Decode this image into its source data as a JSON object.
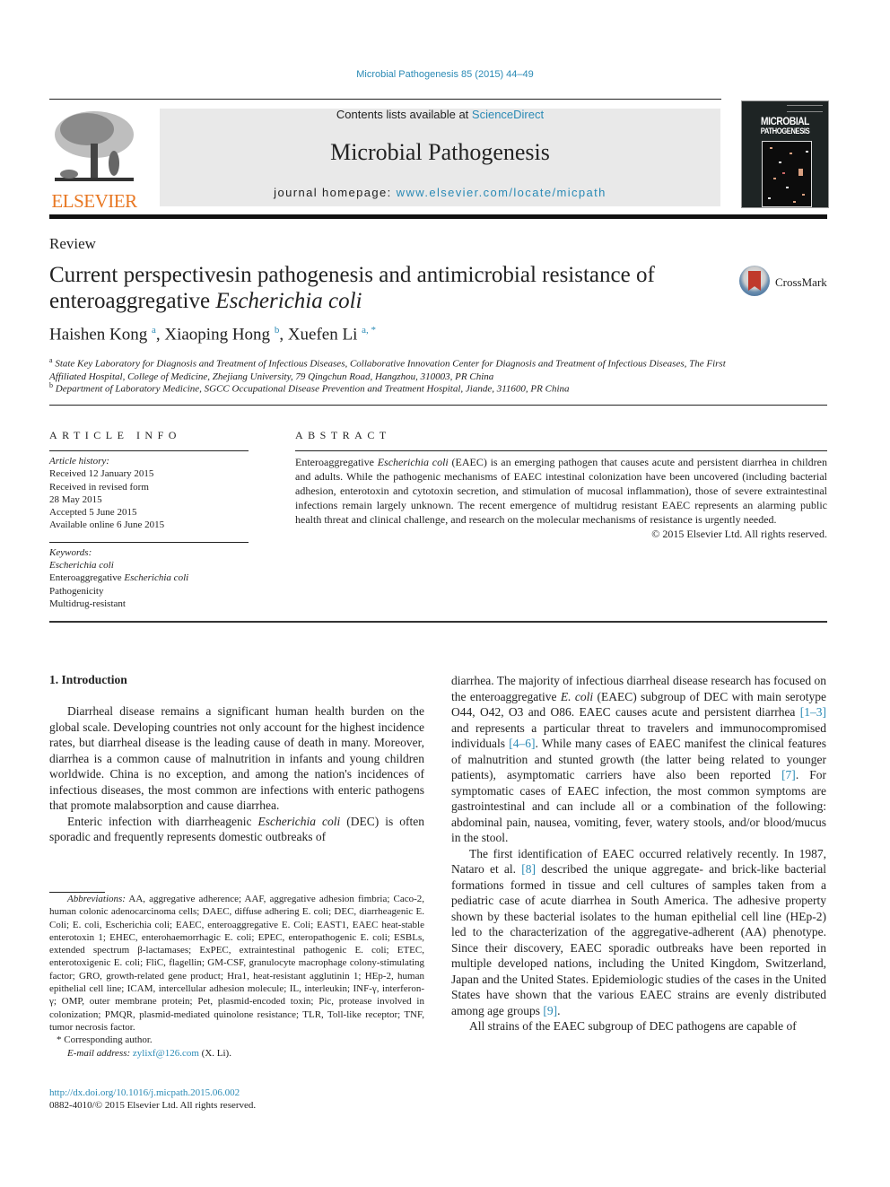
{
  "header": {
    "journal_citation": "Microbial Pathogenesis 85 (2015) 44–49",
    "publisher_logo_text": "ELSEVIER",
    "contents_prefix": "Contents lists available at ",
    "contents_link": "ScienceDirect",
    "journal_title": "Microbial Pathogenesis",
    "homepage_prefix": "journal homepage: ",
    "homepage_link": "www.elsevier.com/locate/micpath",
    "cover_title_line1": "MICROBIAL",
    "cover_title_line2": "PATHOGENESIS"
  },
  "article": {
    "type": "Review",
    "title_part1": "Current perspectivesin pathogenesis and antimicrobial resistance of enteroaggregative ",
    "title_italic": "Escherichia coli",
    "crossmark_label": "CrossMark",
    "authors": [
      {
        "name": "Haishen Kong",
        "sup": "a"
      },
      {
        "name": "Xiaoping Hong",
        "sup": "b"
      },
      {
        "name": "Xuefen Li",
        "sup": "a, *"
      }
    ],
    "affiliations": [
      {
        "mark": "a",
        "text": "State Key Laboratory for Diagnosis and Treatment of Infectious Diseases, Collaborative Innovation Center for Diagnosis and Treatment of Infectious Diseases, The First Affiliated Hospital, College of Medicine, Zhejiang University, 79 Qingchun Road, Hangzhou, 310003, PR China"
      },
      {
        "mark": "b",
        "text": "Department of Laboratory Medicine, SGCC Occupational Disease Prevention and Treatment Hospital, Jiande, 311600, PR China"
      }
    ]
  },
  "article_info": {
    "heading": "ARTICLE INFO",
    "history_label": "Article history:",
    "history": [
      "Received 12 January 2015",
      "Received in revised form",
      "28 May 2015",
      "Accepted 5 June 2015",
      "Available online 6 June 2015"
    ],
    "keywords_label": "Keywords:",
    "keyword1_italic": "Escherichia coli",
    "keyword2_prefix": "Enteroaggregative ",
    "keyword2_italic": "Escherichia coli",
    "keyword3": "Pathogenicity",
    "keyword4": "Multidrug-resistant"
  },
  "abstract": {
    "heading": "ABSTRACT",
    "p1_a": "Enteroaggregative ",
    "p1_i": "Escherichia coli",
    "p1_b": " (EAEC) is an emerging pathogen that causes acute and persistent diarrhea in children and adults. While the pathogenic mechanisms of EAEC intestinal colonization have been uncovered (including bacterial adhesion, enterotoxin and cytotoxin secretion, and stimulation of mucosal inflammation), those of severe extraintestinal infections remain largely unknown. The recent emergence of multidrug resistant EAEC represents an alarming public health threat and clinical challenge, and research on the molecular mechanisms of resistance is urgently needed.",
    "copyright": "© 2015 Elsevier Ltd. All rights reserved."
  },
  "body": {
    "section_heading": "1.  Introduction",
    "left_p1": "Diarrheal disease remains a significant human health burden on the global scale. Developing countries not only account for the highest incidence rates, but diarrheal disease is the leading cause of death in many. Moreover, diarrhea is a common cause of malnutrition in infants and young children worldwide. China is no exception, and among the nation's incidences of infectious diseases, the most common are infections with enteric pathogens that promote malabsorption and cause diarrhea.",
    "left_p2_a": "Enteric infection with diarrheagenic ",
    "left_p2_i": "Escherichia coli",
    "left_p2_b": " (DEC) is often sporadic and frequently represents domestic outbreaks of",
    "right_p1_a": "diarrhea. The majority of infectious diarrheal disease research has focused on the enteroaggregative ",
    "right_p1_i": "E. coli",
    "right_p1_b": " (EAEC) subgroup of DEC with main serotype O44, O42, O3 and O86. EAEC causes acute and persistent diarrhea ",
    "ref_1_3": "[1–3]",
    "right_p1_c": " and represents a particular threat to travelers and immunocompromised individuals ",
    "ref_4_6": "[4–6]",
    "right_p1_d": ". While many cases of EAEC manifest the clinical features of malnutrition and stunted growth (the latter being related to younger patients), asymptomatic carriers have also been reported ",
    "ref_7": "[7]",
    "right_p1_e": ". For symptomatic cases of EAEC infection, the most common symptoms are gastrointestinal and can include all or a combination of the following: abdominal pain, nausea, vomiting, fever, watery stools, and/or blood/mucus in the stool.",
    "right_p2_a": "The first identification of EAEC occurred relatively recently. In 1987, Nataro et al. ",
    "ref_8": "[8]",
    "right_p2_b": " described the unique aggregate- and brick-like bacterial formations formed in tissue and cell cultures of samples taken from a pediatric case of acute diarrhea in South America. The adhesive property shown by these bacterial isolates to the human epithelial cell line (HEp-2) led to the characterization of the aggregative-adherent (AA) phenotype. Since their discovery, EAEC sporadic outbreaks have been reported in multiple developed nations, including the United Kingdom, Switzerland, Japan and the United States. Epidemiologic studies of the cases in the United States have shown that the various EAEC strains are evenly distributed among age groups ",
    "ref_9": "[9]",
    "right_p2_c": ".",
    "right_p3": "All strains of the EAEC subgroup of DEC pathogens are capable of"
  },
  "footnotes": {
    "abbrev_label": "Abbreviations:",
    "abbrev_text": " AA, aggregative adherence; AAF, aggregative adhesion fimbria; Caco-2, human colonic adenocarcinoma cells; DAEC, diffuse adhering E. coli; DEC, diarrheagenic E. Coli; E. coli, Escherichia coli; EAEC, enteroaggregative E. Coli; EAST1, EAEC heat-stable enterotoxin 1; EHEC, enterohaemorrhagic E. coli; EPEC, enteropathogenic E. coli; ESBLs, extended spectrum β-lactamases; ExPEC, extraintestinal pathogenic E. coli; ETEC, enterotoxigenic E. coli; FliC, flagellin; GM-CSF, granulocyte macrophage colony-stimulating factor; GRO, growth-related gene product; Hra1, heat-resistant agglutinin 1; HEp-2, human epithelial cell line; ICAM, intercellular adhesion molecule; IL, interleukin; INF-γ, interferon-γ; OMP, outer membrane protein; Pet, plasmid-encoded toxin; Pic, protease involved in colonization; PMQR, plasmid-mediated quinolone resistance; TLR, Toll-like receptor; TNF, tumor necrosis factor.",
    "corresponding": "*  Corresponding author.",
    "email_label": "E-mail address: ",
    "email": "zylixf@126.com",
    "email_suffix": " (X. Li).",
    "doi": "http://dx.doi.org/10.1016/j.micpath.2015.06.002",
    "issn": "0882-4010/© 2015 Elsevier Ltd. All rights reserved."
  },
  "colors": {
    "link": "#2a8ab5",
    "elsevier_orange": "#e87722",
    "banner_bg": "#e9e9e9"
  }
}
